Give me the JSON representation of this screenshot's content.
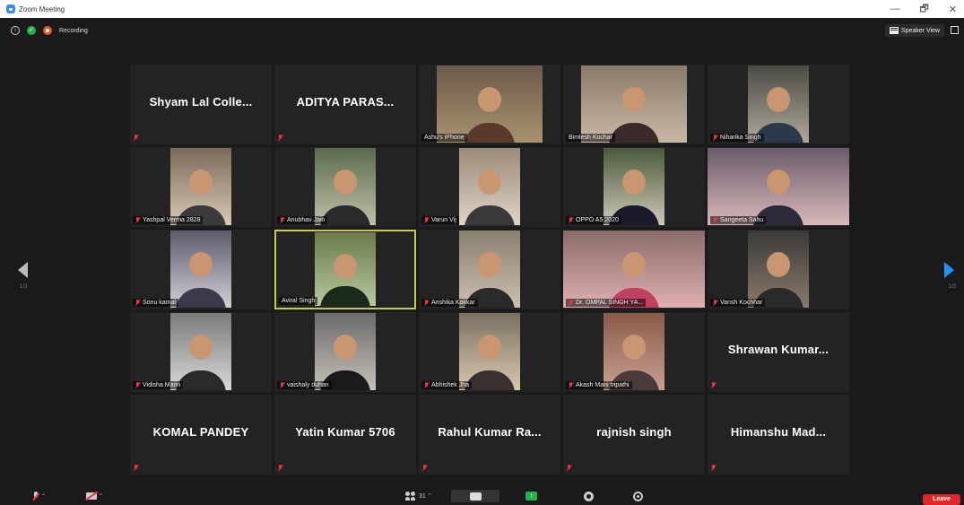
{
  "window": {
    "title": "Zoom Meeting",
    "minimize": "—",
    "maximize": "🗗",
    "close": "✕"
  },
  "topbar": {
    "recording_label": "Recording",
    "speaker_view_label": "Speaker View"
  },
  "pagination": {
    "left_page": "1/3",
    "right_page": "1/3"
  },
  "participants": [
    {
      "name": "Shyam Lal Colle...",
      "video": false
    },
    {
      "name": "ADITYA PARAS...",
      "video": false
    },
    {
      "name": "Ashu's iPhone",
      "video": true,
      "muted": false
    },
    {
      "name": "Bimlesh Kochar",
      "video": true,
      "muted": false
    },
    {
      "name": "Niharika Singh",
      "video": true,
      "muted": true
    },
    {
      "name": "Yashpal Verma 2828",
      "video": true,
      "muted": true
    },
    {
      "name": "Anubhav Jain",
      "video": true,
      "muted": true
    },
    {
      "name": "Varun Vij",
      "video": true,
      "muted": true
    },
    {
      "name": "OPPO A5 2020",
      "video": true,
      "muted": true
    },
    {
      "name": "Sangeeta Sahu",
      "video": true,
      "muted": true
    },
    {
      "name": "Sonu kamal",
      "video": true,
      "muted": true
    },
    {
      "name": "Aviral Singh",
      "video": true,
      "muted": false,
      "active": true
    },
    {
      "name": "Anshika Kakkar",
      "video": true,
      "muted": true
    },
    {
      "name": "Dr. OMPAL SINGH YA...",
      "video": true,
      "muted": true
    },
    {
      "name": "Vansh Kochhar",
      "video": true,
      "muted": true
    },
    {
      "name": "Vidisha Mann",
      "video": true,
      "muted": true
    },
    {
      "name": "vaishaly duhan",
      "video": true,
      "muted": true
    },
    {
      "name": "Abhishek Jha",
      "video": true,
      "muted": true
    },
    {
      "name": "Akash Mani tripathi",
      "video": true,
      "muted": true
    },
    {
      "name": "Shrawan Kumar...",
      "video": false
    },
    {
      "name": "KOMAL PANDEY",
      "video": false
    },
    {
      "name": "Yatin Kumar 5706",
      "video": false
    },
    {
      "name": "Rahul Kumar Ra...",
      "video": false
    },
    {
      "name": "rajnish singh",
      "video": false
    },
    {
      "name": "Himanshu Mad...",
      "video": false
    }
  ],
  "toolbar": {
    "participants_count": "31",
    "leave_label": "Leave"
  },
  "colors": {
    "active_speaker_border": "#c5cc4a",
    "leave_button": "#e02828",
    "share_button": "#23b24a",
    "next_page_arrow": "#1e90ff"
  }
}
